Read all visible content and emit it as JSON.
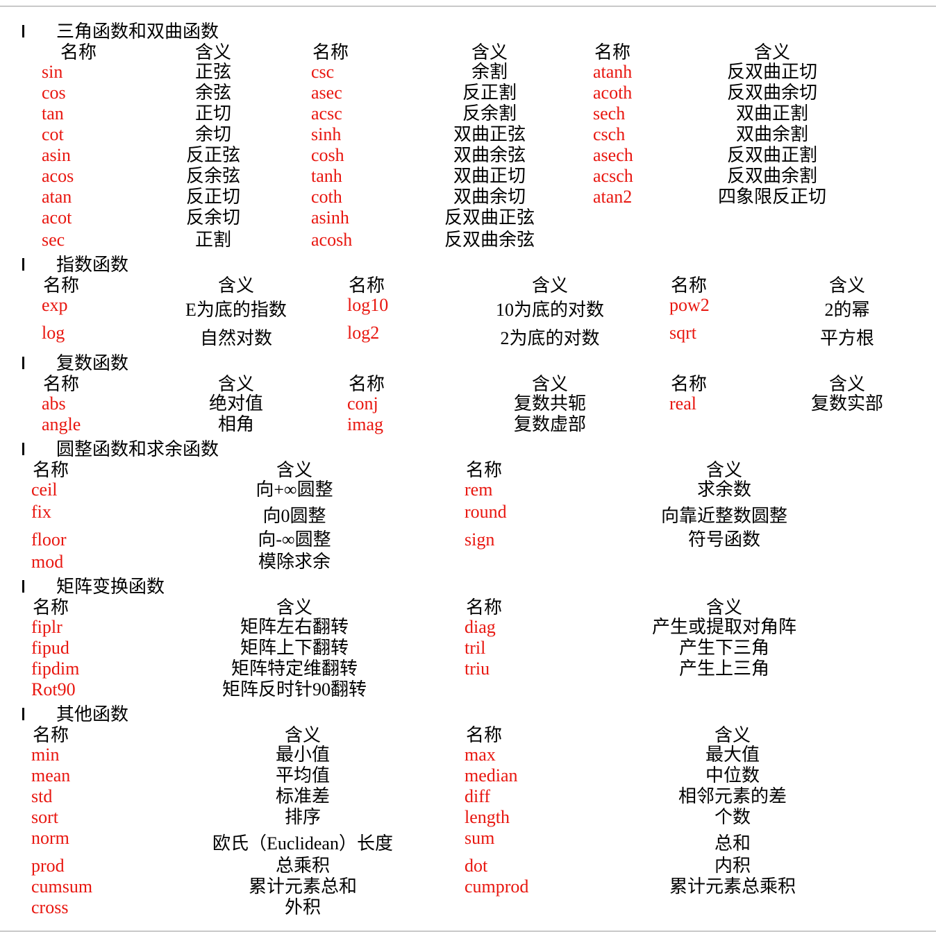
{
  "colors": {
    "function_name": "#e8160f",
    "text": "#000000",
    "rule": "#c8c8c8"
  },
  "bullet_glyph": "l",
  "sections": [
    {
      "title": "三角函数和双曲函数",
      "header": {
        "name": "名称",
        "meaning": "含义"
      },
      "rows": [
        [
          [
            "sin",
            "正弦"
          ],
          [
            "csc",
            "余割"
          ],
          [
            "atanh",
            "反双曲正切"
          ]
        ],
        [
          [
            "cos",
            "余弦"
          ],
          [
            "asec",
            "反正割"
          ],
          [
            "acoth",
            "反双曲余切"
          ]
        ],
        [
          [
            "tan",
            "正切"
          ],
          [
            "acsc",
            "反余割"
          ],
          [
            "sech",
            "双曲正割"
          ]
        ],
        [
          [
            "cot",
            "余切"
          ],
          [
            "sinh",
            "双曲正弦"
          ],
          [
            "csch",
            "双曲余割"
          ]
        ],
        [
          [
            "asin",
            "反正弦"
          ],
          [
            "cosh",
            "双曲余弦"
          ],
          [
            "asech",
            "反双曲正割"
          ]
        ],
        [
          [
            "acos",
            "反余弦"
          ],
          [
            "tanh",
            "双曲正切"
          ],
          [
            "acsch",
            "反双曲余割"
          ]
        ],
        [
          [
            "atan",
            "反正切"
          ],
          [
            "coth",
            "双曲余切"
          ],
          [
            "atan2",
            "四象限反正切"
          ]
        ],
        [
          [
            "acot",
            "反余切"
          ],
          [
            "asinh",
            "反双曲正弦"
          ]
        ],
        [
          [
            "sec",
            "正割"
          ],
          [
            "acosh",
            "反双曲余弦"
          ]
        ]
      ]
    },
    {
      "title": "指数函数",
      "header": {
        "name": "名称",
        "meaning": "含义"
      },
      "rows": [
        [
          [
            "exp",
            "E为底的指数"
          ],
          [
            "log10",
            "10为底的对数"
          ],
          [
            "pow2",
            "2的幂"
          ]
        ],
        [
          [
            "log",
            "自然对数"
          ],
          [
            "log2",
            "2为底的对数"
          ],
          [
            "sqrt",
            "平方根"
          ]
        ]
      ]
    },
    {
      "title": "复数函数",
      "header": {
        "name": "名称",
        "meaning": "含义"
      },
      "rows": [
        [
          [
            "abs",
            "绝对值"
          ],
          [
            "conj",
            "复数共轭"
          ],
          [
            "real",
            "复数实部"
          ]
        ],
        [
          [
            "angle",
            "相角"
          ],
          [
            "imag",
            "复数虚部"
          ]
        ]
      ]
    },
    {
      "title": "圆整函数和求余函数",
      "header": {
        "name": "名称",
        "meaning": "含义"
      },
      "rows": [
        [
          [
            "ceil",
            "向+∞圆整"
          ],
          [
            "rem",
            "求余数"
          ]
        ],
        [
          [
            "fix",
            "向0圆整"
          ],
          [
            "round",
            "向靠近整数圆整"
          ]
        ],
        [
          [
            "floor",
            "向-∞圆整"
          ],
          [
            "sign",
            "符号函数"
          ]
        ],
        [
          [
            "mod",
            "模除求余"
          ]
        ]
      ]
    },
    {
      "title": "矩阵变换函数",
      "header": {
        "name": "名称",
        "meaning": "含义"
      },
      "rows": [
        [
          [
            "fiplr",
            "矩阵左右翻转"
          ],
          [
            "diag",
            "产生或提取对角阵"
          ]
        ],
        [
          [
            "fipud",
            "矩阵上下翻转"
          ],
          [
            "tril",
            "产生下三角"
          ]
        ],
        [
          [
            "fipdim",
            "矩阵特定维翻转"
          ],
          [
            "triu",
            "产生上三角"
          ]
        ],
        [
          [
            "Rot90",
            "矩阵反时针90翻转"
          ]
        ]
      ]
    },
    {
      "title": "其他函数",
      "header": {
        "name": "名称",
        "meaning": "含义"
      },
      "rows": [
        [
          [
            "min",
            "最小值"
          ],
          [
            "max",
            "最大值"
          ]
        ],
        [
          [
            "mean",
            "平均值"
          ],
          [
            "median",
            "中位数"
          ]
        ],
        [
          [
            "std",
            "标准差"
          ],
          [
            "diff",
            "相邻元素的差"
          ]
        ],
        [
          [
            "sort",
            "排序"
          ],
          [
            "length",
            "个数"
          ]
        ],
        [
          [
            "norm",
            "欧氏（Euclidean）长度"
          ],
          [
            "sum",
            "总和"
          ]
        ],
        [
          [
            "prod",
            "总乘积"
          ],
          [
            "dot",
            "内积"
          ]
        ],
        [
          [
            "cumsum",
            "累计元素总和"
          ],
          [
            "cumprod",
            "累计元素总乘积"
          ]
        ],
        [
          [
            "cross",
            "外积"
          ]
        ]
      ]
    }
  ]
}
